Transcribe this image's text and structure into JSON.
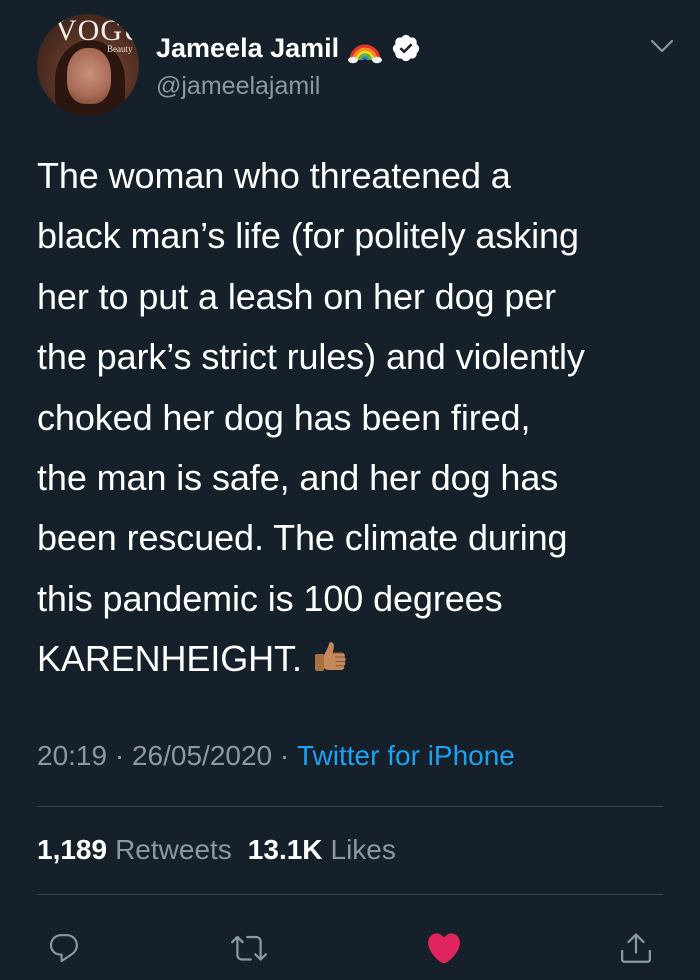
{
  "tweet": {
    "author": {
      "name": "Jameela Jamil",
      "handle": "@jameelajamil",
      "avatar_magazine_text": "VOGUE",
      "avatar_sub_text": "Beauty",
      "verified": true
    },
    "text_lines": [
      "The woman who threatened a",
      "black man’s life (for politely asking",
      "her to put a leash on her dog per",
      "the park’s strict rules) and violently",
      "choked her dog has been fired,",
      "the man is safe,  and her dog has",
      "been rescued. The climate during",
      "this pandemic is 100 degrees",
      "KARENHEIGHT."
    ],
    "emoji": "thumbs-up-icon",
    "meta": {
      "time": "20:19",
      "separator": " · ",
      "date": "26/05/2020",
      "source": "Twitter for iPhone"
    },
    "stats": {
      "retweets_count": "1,189",
      "retweets_label": "Retweets",
      "likes_count": "13.1K",
      "likes_label": "Likes"
    }
  },
  "colors": {
    "background": "#15202b",
    "text": "#ffffff",
    "secondary_text": "#8899a6",
    "link": "#1da1f2",
    "divider": "#38444d",
    "like_active": "#e0245e",
    "verified": "#ffffff"
  },
  "actions": [
    {
      "name": "reply",
      "icon": "reply-icon"
    },
    {
      "name": "retweet",
      "icon": "retweet-icon"
    },
    {
      "name": "like",
      "icon": "heart-icon",
      "active": true
    },
    {
      "name": "share",
      "icon": "share-icon"
    }
  ]
}
